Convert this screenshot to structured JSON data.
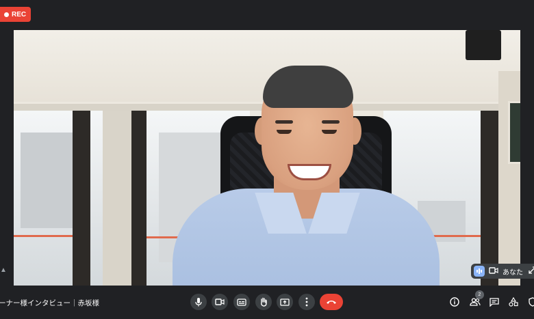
{
  "recording": {
    "label": "REC"
  },
  "meeting": {
    "title": "ーナー様インタビュー｜赤坂様"
  },
  "self_view": {
    "label": "あなた"
  },
  "participants": {
    "count": "2"
  },
  "colors": {
    "end_call": "#ea4335",
    "rec": "#ea4335",
    "control_bg": "#3c4043",
    "active_mic": "#8ab4f8"
  },
  "icons": {
    "controls": [
      "mic-icon",
      "camera-icon",
      "captions-icon",
      "raise-hand-icon",
      "present-screen-icon",
      "more-options-icon",
      "end-call-icon"
    ],
    "right": [
      "info-icon",
      "people-icon",
      "chat-icon",
      "activities-icon",
      "host-controls-icon"
    ]
  }
}
